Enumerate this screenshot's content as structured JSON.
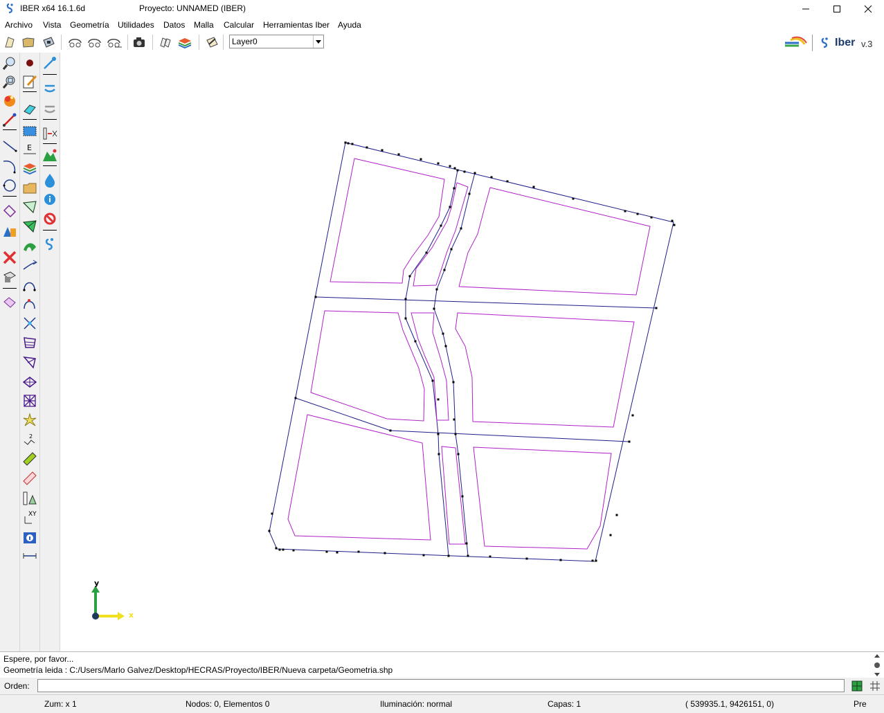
{
  "window": {
    "app_title": "IBER x64 16.1.6d",
    "project_title": "Proyecto: UNNAMED (IBER)"
  },
  "menu": [
    "Archivo",
    "Vista",
    "Geometría",
    "Utilidades",
    "Datos",
    "Malla",
    "Calcular",
    "Herramientas Iber",
    "Ayuda"
  ],
  "toolbar": {
    "layer_value": "Layer0",
    "brand": "Iber",
    "version": "v.3"
  },
  "axes": {
    "y_label": "y",
    "x_label": "x"
  },
  "output": {
    "line1": "Espere, por favor...",
    "line2": "Geometría leida : C:/Users/Marlo Galvez/Desktop/HECRAS/Proyecto/IBER/Nueva carpeta/Geometria.shp"
  },
  "command": {
    "label": "Orden:",
    "value": ""
  },
  "status": {
    "zoom": "Zum: x 1",
    "nodes": "Nodos: 0, Elementos 0",
    "lighting": "Iluminación: normal",
    "layers": "Capas: 1",
    "coords": "( 539935.1,  9426151,  0)",
    "mode": "Pre"
  },
  "colors": {
    "boundary": "#1e1e8a",
    "block": "#b020c8",
    "point": "#000000"
  },
  "icons": {
    "top": [
      "new-icon",
      "open-icon",
      "save-icon",
      "undo-icon",
      "redo-icon",
      "redo-all-icon",
      "camera-icon",
      "view-icon",
      "layers-icon",
      "edit-icon"
    ],
    "left1": [
      "zoom-icon",
      "zoom-frame-icon",
      "render-icon",
      "rotate-icon",
      "line-icon",
      "arc-icon",
      "circle-icon",
      "surface-icon",
      "volume-icon",
      "delete-icon",
      "layers-edit-icon",
      "measure-icon"
    ],
    "left2": [
      "point-icon",
      "pencil-icon",
      "eraser-icon",
      "rectangle-icon",
      "label-icon",
      "layers-stack-icon",
      "folder-icon",
      "mesh-tool-icon",
      "mesh-fill-icon",
      "surface-green-icon",
      "arrow-curve-icon",
      "curve-nodes-icon",
      "curve-red-icon",
      "intersect-icon",
      "mesh-struct-icon",
      "mesh-tri-icon",
      "mesh-cross-icon",
      "mesh-grid-icon",
      "explode-icon",
      "renumber-icon",
      "ruler-diag-icon",
      "ruler-icon",
      "triangle-ruler-icon",
      "xy-icon",
      "info-blue-icon",
      "dimension-icon"
    ],
    "left3": [
      "brush-icon",
      "inlet-icon",
      "outlet-icon",
      "bridge-icon",
      "terrain-icon",
      "water-drop-icon",
      "info-icon",
      "stop-icon",
      "iber-logo-icon"
    ]
  }
}
